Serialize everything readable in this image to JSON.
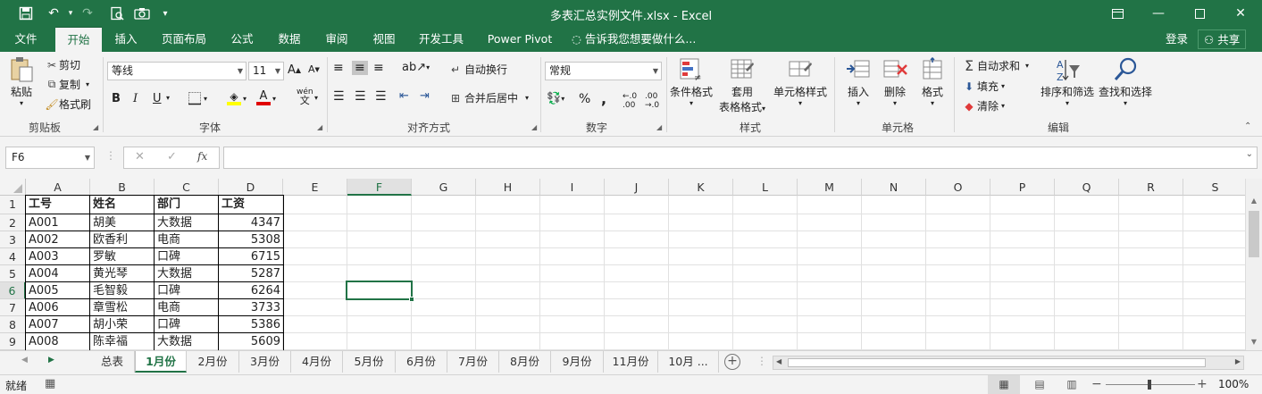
{
  "window": {
    "title": "多表汇总实例文件.xlsx - Excel",
    "save_icon": "save-icon",
    "undo_icon": "undo-icon",
    "redo_icon": "redo-icon",
    "accent_color": "#217346"
  },
  "ribbon_tabs": [
    "文件",
    "开始",
    "插入",
    "页面布局",
    "公式",
    "数据",
    "审阅",
    "视图",
    "开发工具",
    "Power Pivot"
  ],
  "active_tab": "开始",
  "tell_me": "告诉我您想要做什么...",
  "account": {
    "login": "登录",
    "share": "共享"
  },
  "ribbon": {
    "clipboard": {
      "label": "剪贴板",
      "paste": "粘贴",
      "cut": "剪切",
      "copy": "复制",
      "format_painter": "格式刷"
    },
    "font": {
      "label": "字体",
      "font_name": "等线",
      "font_size": "11",
      "bold": "B",
      "italic": "I",
      "underline": "U",
      "phonetic": "wén"
    },
    "alignment": {
      "label": "对齐方式",
      "wrap": "自动换行",
      "merge": "合并后居中"
    },
    "number": {
      "label": "数字",
      "format": "常规",
      "percent": "%",
      "comma": ","
    },
    "styles": {
      "label": "样式",
      "conditional": "条件格式",
      "table_line1": "套用",
      "table_line2": "表格格式",
      "cell_styles": "单元格样式"
    },
    "cells": {
      "label": "单元格",
      "insert": "插入",
      "delete": "删除",
      "format": "格式"
    },
    "editing": {
      "label": "编辑",
      "autosum": "自动求和",
      "fill": "填充",
      "clear": "清除",
      "sort": "排序和筛选",
      "find": "查找和选择"
    }
  },
  "formula_bar": {
    "name_box": "F6",
    "fx": "fx",
    "value": ""
  },
  "columns": [
    "A",
    "B",
    "C",
    "D",
    "E",
    "F",
    "G",
    "H",
    "I",
    "J",
    "K",
    "L",
    "M",
    "N",
    "O",
    "P",
    "Q",
    "R",
    "S"
  ],
  "rows": [
    "1",
    "2",
    "3",
    "4",
    "5",
    "6",
    "7",
    "8",
    "9"
  ],
  "table": {
    "headers": [
      "工号",
      "姓名",
      "部门",
      "工资"
    ],
    "data": [
      [
        "A001",
        "胡美",
        "大数据",
        "4347"
      ],
      [
        "A002",
        "欧香利",
        "电商",
        "5308"
      ],
      [
        "A003",
        "罗敏",
        "口碑",
        "6715"
      ],
      [
        "A004",
        "黄光琴",
        "大数据",
        "5287"
      ],
      [
        "A005",
        "毛智毅",
        "口碑",
        "6264"
      ],
      [
        "A006",
        "章雪松",
        "电商",
        "3733"
      ],
      [
        "A007",
        "胡小荣",
        "口碑",
        "5386"
      ],
      [
        "A008",
        "陈幸福",
        "大数据",
        "5609"
      ]
    ]
  },
  "sheet_tabs": [
    "总表",
    "1月份",
    "2月份",
    "3月份",
    "4月份",
    "5月份",
    "6月份",
    "7月份",
    "8月份",
    "9月份",
    "11月份",
    "10月 ..."
  ],
  "active_sheet": "1月份",
  "status": {
    "ready": "就绪",
    "zoom": "100%"
  }
}
